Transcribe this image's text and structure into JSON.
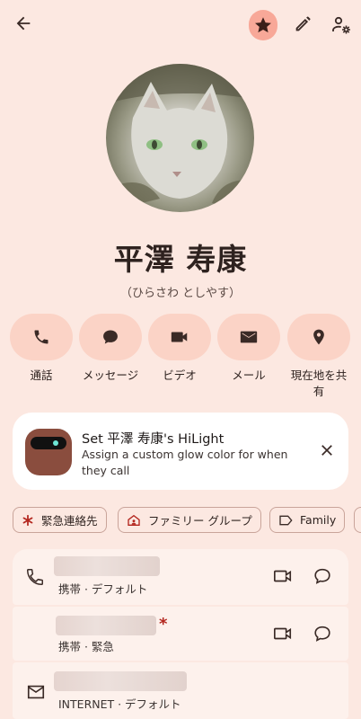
{
  "contact": {
    "name": "平澤 寿康",
    "reading": "（ひらさわ としやす）"
  },
  "actions": [
    {
      "label": "通話",
      "icon": "phone-icon"
    },
    {
      "label": "メッセージ",
      "icon": "message-icon"
    },
    {
      "label": "ビデオ",
      "icon": "video-icon"
    },
    {
      "label": "メール",
      "icon": "mail-icon"
    },
    {
      "label": "現在地を共\n有",
      "icon": "location-icon"
    }
  ],
  "hilight": {
    "title": "Set 平澤 寿康's HiLight",
    "description": "Assign a custom glow color for when they call"
  },
  "chips": [
    {
      "label": "緊急連絡先",
      "icon": "asterisk-icon"
    },
    {
      "label": "ファミリー グループ",
      "icon": "home-group-icon"
    },
    {
      "label": "Family",
      "icon": "label-icon"
    }
  ],
  "entries": [
    {
      "subtitle": "携帯 · デフォルト",
      "icon": "phone-icon"
    },
    {
      "subtitle": "携帯 · 緊急",
      "icon": "",
      "emergency_mark": "*"
    },
    {
      "subtitle": "INTERNET · デフォルト",
      "icon": "mail-icon"
    }
  ],
  "colors": {
    "background": "#fce8e1",
    "accent": "#f8a898",
    "emergency": "#b3261e"
  }
}
